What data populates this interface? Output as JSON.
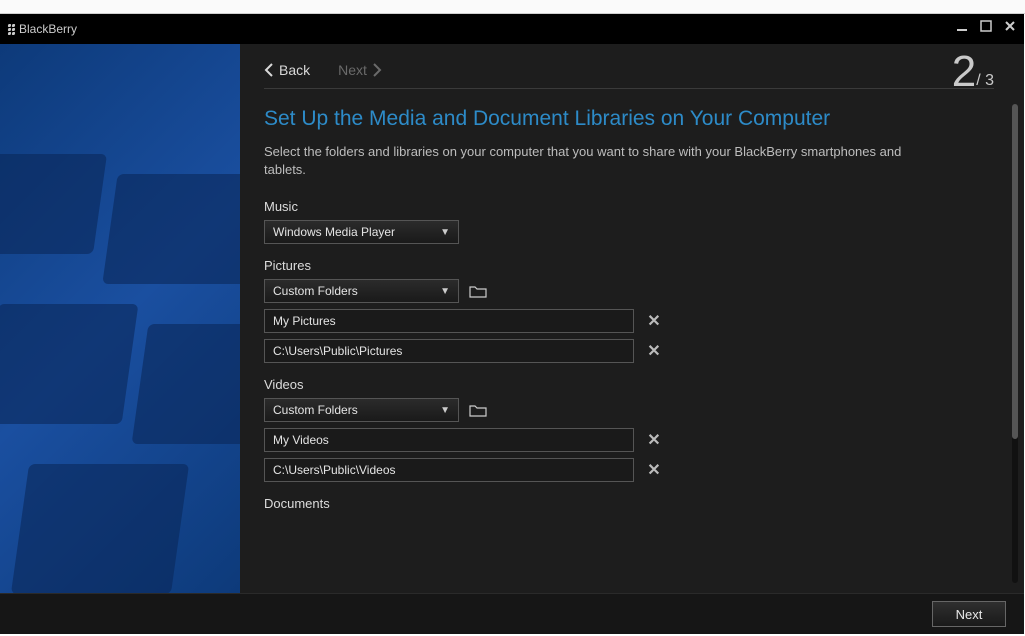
{
  "brand": "BlackBerry",
  "nav": {
    "back": "Back",
    "next": "Next"
  },
  "step": {
    "current": "2",
    "separator": "/ 3"
  },
  "page": {
    "title": "Set Up the Media and Document Libraries on Your Computer",
    "intro": "Select the folders and libraries on your computer that you want to share with your BlackBerry smartphones and tablets."
  },
  "sections": {
    "music": {
      "label": "Music",
      "select": "Windows Media Player"
    },
    "pictures": {
      "label": "Pictures",
      "select": "Custom Folders",
      "paths": [
        "My Pictures",
        "C:\\Users\\Public\\Pictures"
      ]
    },
    "videos": {
      "label": "Videos",
      "select": "Custom Folders",
      "paths": [
        "My Videos",
        "C:\\Users\\Public\\Videos"
      ]
    },
    "documents": {
      "label": "Documents"
    }
  },
  "footer": {
    "next": "Next"
  }
}
